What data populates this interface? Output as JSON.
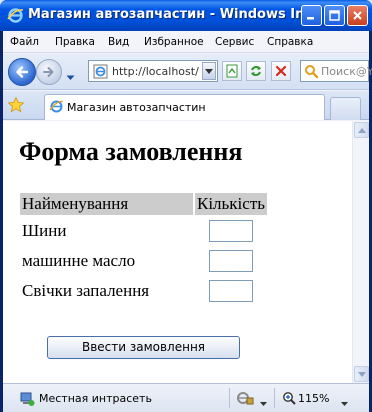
{
  "window": {
    "title": "Магазин автозапчастин - Windows Inter..."
  },
  "menu": {
    "items": [
      "Файл",
      "Правка",
      "Вид",
      "Избранное",
      "Сервис",
      "Справка"
    ]
  },
  "address_bar": {
    "url": "http://localhost/",
    "search_placeholder": "Поиск@Y"
  },
  "tabs": [
    {
      "label": "Магазин автозапчастин"
    }
  ],
  "page": {
    "heading": "Форма замовлення",
    "table": {
      "headers": [
        "Найменування",
        "Кількість"
      ],
      "rows": [
        {
          "item": "Шини",
          "quantity": ""
        },
        {
          "item": "машинне масло",
          "quantity": ""
        },
        {
          "item": "Свічки запалення",
          "quantity": ""
        }
      ]
    },
    "submit_label": "Ввести замовлення"
  },
  "status_bar": {
    "zone": "Местная интрасеть",
    "zoom": "115%"
  },
  "colors": {
    "titlebar": "#0055e5",
    "header_bg": "#cccccc",
    "content_bg": "#ffffff"
  }
}
